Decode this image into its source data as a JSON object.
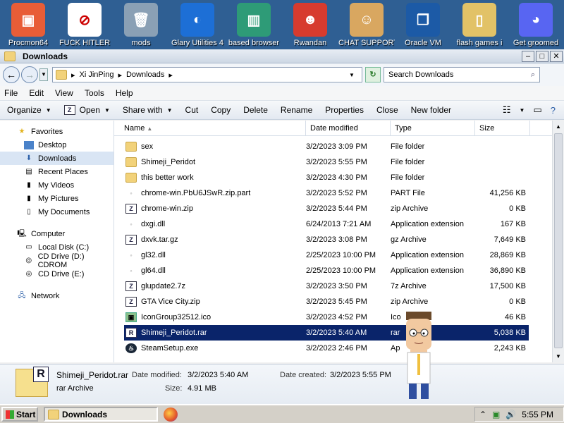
{
  "desktop": {
    "icons": [
      {
        "label": "Procmon64",
        "color": "#e85d37",
        "glyph": "▣"
      },
      {
        "label": "FUCK HITLER",
        "color": "#ffffff",
        "glyph": "⊘"
      },
      {
        "label": "mods",
        "color": "#8aa0b5",
        "glyph": "🗑"
      },
      {
        "label": "Glary Utilities 4",
        "color": "#1d6fd6",
        "glyph": "◐"
      },
      {
        "label": "based browser",
        "color": "#2e9b77",
        "glyph": "▥"
      },
      {
        "label": "Rwandan",
        "color": "#d73b2e",
        "glyph": "☻"
      },
      {
        "label": "CHAT SUPPORT",
        "color": "#d9a760",
        "glyph": "☺"
      },
      {
        "label": "Oracle VM",
        "color": "#1c5aa6",
        "glyph": "❒"
      },
      {
        "label": "flash games i",
        "color": "#e2c267",
        "glyph": "▯"
      },
      {
        "label": "Get groomed",
        "color": "#5865f2",
        "glyph": "◕"
      }
    ]
  },
  "window": {
    "title": "Downloads",
    "controls": {
      "minimize": "–",
      "maximize": "□",
      "close": "✕"
    },
    "address": {
      "segments": [
        "Xi JinPing",
        "Downloads"
      ]
    },
    "search_placeholder": "Search Downloads",
    "menu": [
      "File",
      "Edit",
      "View",
      "Tools",
      "Help"
    ],
    "toolbar": {
      "organize": "Organize",
      "open": "Open",
      "share_with": "Share with",
      "cut": "Cut",
      "copy": "Copy",
      "delete": "Delete",
      "rename": "Rename",
      "properties": "Properties",
      "close": "Close",
      "new_folder": "New folder"
    }
  },
  "nav": {
    "favorites": {
      "label": "Favorites",
      "items": [
        "Desktop",
        "Downloads",
        "Recent Places",
        "My Videos",
        "My Pictures",
        "My Documents"
      ]
    },
    "computer": {
      "label": "Computer",
      "items": [
        "Local Disk (C:)",
        "CD Drive (D:) CDROM",
        "CD Drive (E:)"
      ]
    },
    "network": {
      "label": "Network"
    }
  },
  "columns": {
    "name": "Name",
    "date": "Date modified",
    "type": "Type",
    "size": "Size"
  },
  "files": [
    {
      "icon": "folder",
      "name": "sex",
      "date": "3/2/2023 3:09 PM",
      "type": "File folder",
      "size": ""
    },
    {
      "icon": "folder",
      "name": "Shimeji_Peridot",
      "date": "3/2/2023 5:55 PM",
      "type": "File folder",
      "size": ""
    },
    {
      "icon": "folder",
      "name": "this better work",
      "date": "3/2/2023 4:30 PM",
      "type": "File folder",
      "size": ""
    },
    {
      "icon": "doc",
      "name": "chrome-win.PbU6JSwR.zip.part",
      "date": "3/2/2023 5:52 PM",
      "type": "PART File",
      "size": "41,256 KB"
    },
    {
      "icon": "zip",
      "name": "chrome-win.zip",
      "date": "3/2/2023 5:44 PM",
      "type": "zip Archive",
      "size": "0 KB"
    },
    {
      "icon": "doc",
      "name": "dxgi.dll",
      "date": "6/24/2013 7:21 AM",
      "type": "Application extension",
      "size": "167 KB"
    },
    {
      "icon": "zip",
      "name": "dxvk.tar.gz",
      "date": "3/2/2023 3:08 PM",
      "type": "gz Archive",
      "size": "7,649 KB"
    },
    {
      "icon": "doc",
      "name": "gl32.dll",
      "date": "2/25/2023 10:00 PM",
      "type": "Application extension",
      "size": "28,869 KB"
    },
    {
      "icon": "doc",
      "name": "gl64.dll",
      "date": "2/25/2023 10:00 PM",
      "type": "Application extension",
      "size": "36,890 KB"
    },
    {
      "icon": "zip",
      "name": "glupdate2.7z",
      "date": "3/2/2023 3:50 PM",
      "type": "7z Archive",
      "size": "17,500 KB"
    },
    {
      "icon": "zip",
      "name": "GTA Vice City.zip",
      "date": "3/2/2023 5:45 PM",
      "type": "zip Archive",
      "size": "0 KB"
    },
    {
      "icon": "img",
      "name": "IconGroup32512.ico",
      "date": "3/2/2023 4:52 PM",
      "type": "Ico",
      "size": "46 KB"
    },
    {
      "icon": "rar",
      "name": "Shimeji_Peridot.rar",
      "date": "3/2/2023 5:40 AM",
      "type": "rar",
      "size": "5,038 KB",
      "selected": true
    },
    {
      "icon": "steam",
      "name": "SteamSetup.exe",
      "date": "3/2/2023 2:46 PM",
      "type": "Ap",
      "size": "2,243 KB"
    }
  ],
  "details": {
    "name": "Shimeji_Peridot.rar",
    "type": "rar Archive",
    "date_modified_label": "Date modified:",
    "date_modified": "3/2/2023 5:40 AM",
    "size_label": "Size:",
    "size": "4.91 MB",
    "date_created_label": "Date created:",
    "date_created": "3/2/2023 5:55 PM"
  },
  "taskbar": {
    "start": "Start",
    "task": "Downloads",
    "clock": "5:55 PM"
  },
  "colors": {
    "selection": "#0a246a",
    "titlebar": "#cdd7e4",
    "taskbar": "#d4d0c8"
  }
}
